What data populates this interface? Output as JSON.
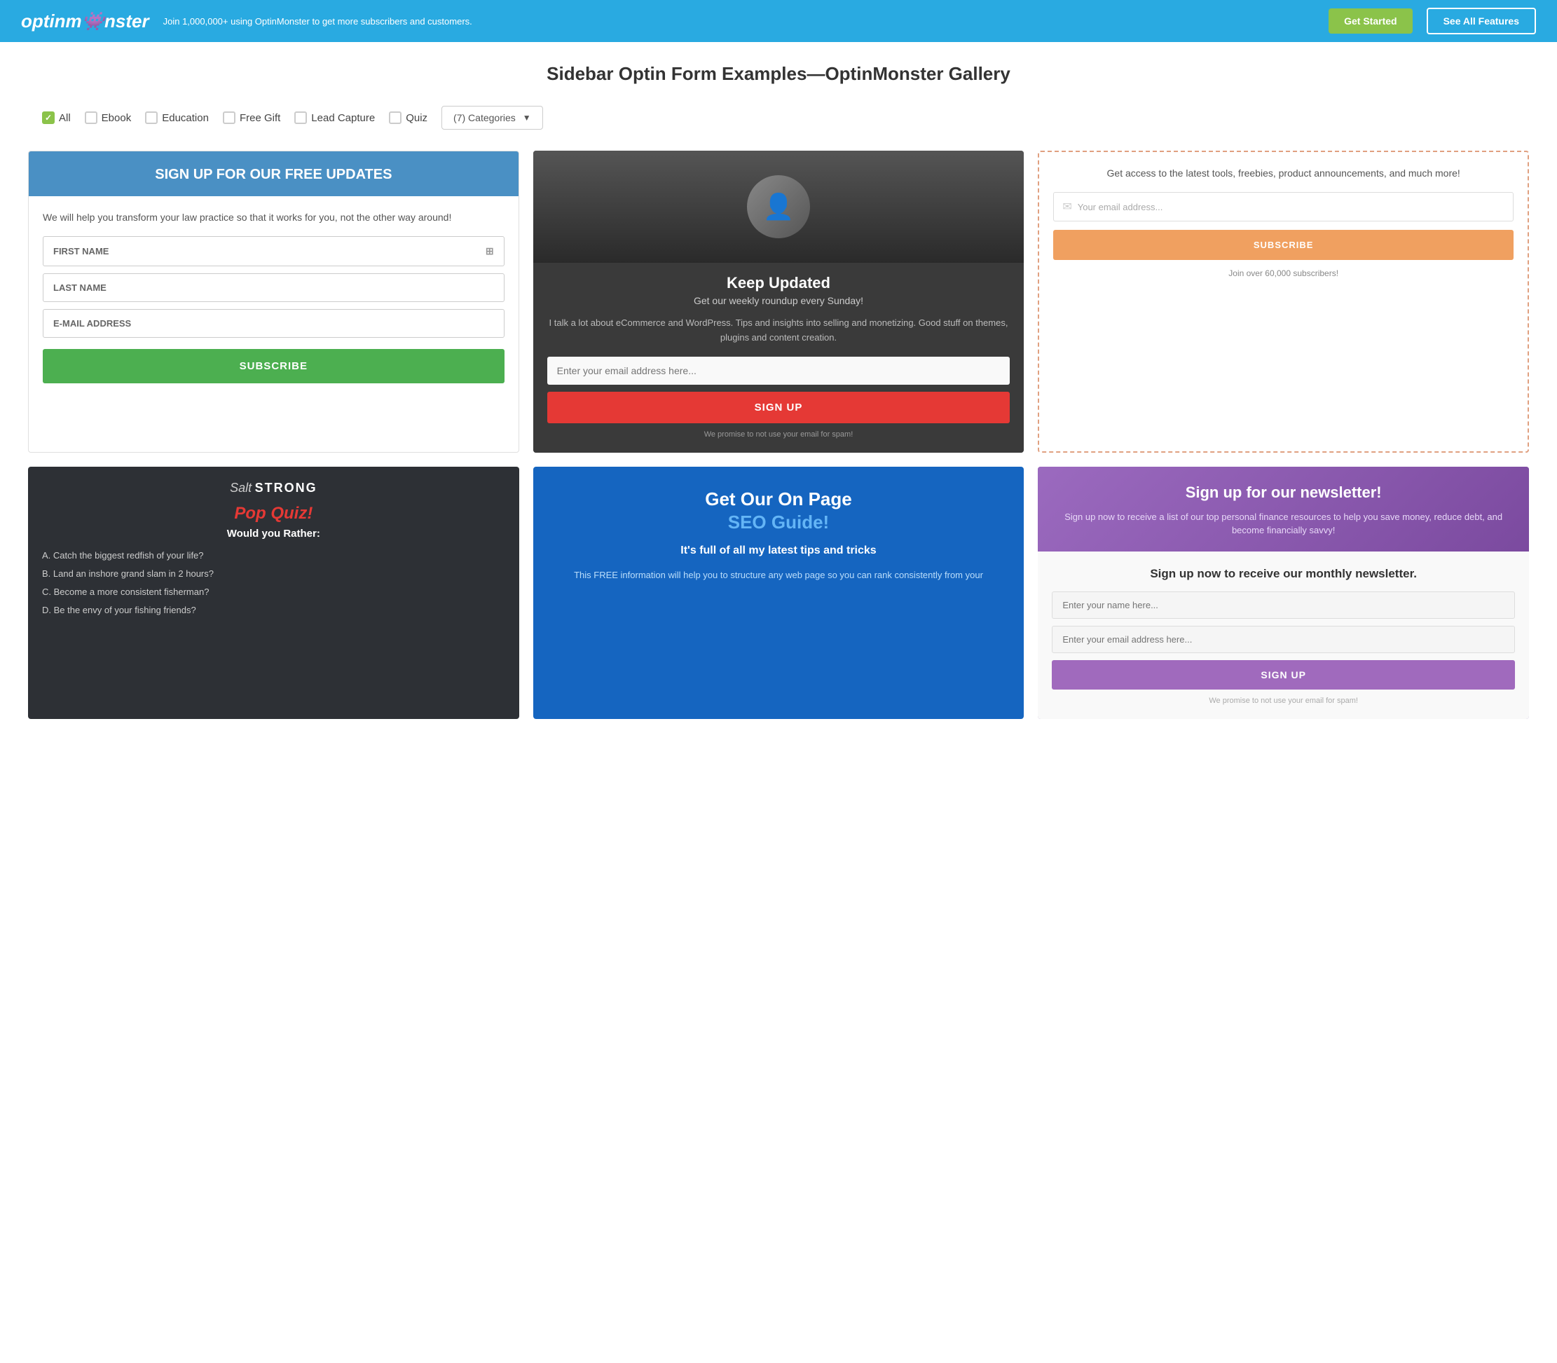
{
  "header": {
    "logo": "optinm",
    "logo_monster": "onster",
    "tagline": "Join 1,000,000+ using OptinMonster to get more subscribers and customers.",
    "btn_get_started": "Get Started",
    "btn_see_features": "See All Features"
  },
  "page": {
    "title": "Sidebar Optin Form Examples—OptinMonster Gallery"
  },
  "filters": {
    "all_label": "All",
    "ebook_label": "Ebook",
    "education_label": "Education",
    "free_gift_label": "Free Gift",
    "lead_capture_label": "Lead Capture",
    "quiz_label": "Quiz",
    "categories_label": "(7) Categories"
  },
  "cards": {
    "card1": {
      "header": "SIGN UP FOR OUR FREE UPDATES",
      "body": "We will help you transform your law practice so that it works for you, not the other way around!",
      "field1": "FIRST NAME",
      "field2": "LAST NAME",
      "field3": "E-MAIL ADDRESS",
      "subscribe_btn": "SUBSCRIBE"
    },
    "card2": {
      "title": "Keep Updated",
      "subtitle": "Get our weekly roundup every Sunday!",
      "desc": "I talk a lot about eCommerce and WordPress. Tips and insights into selling and monetizing. Good stuff on themes, plugins and content creation.",
      "email_placeholder": "Enter your email address here...",
      "signup_btn": "SIGN UP",
      "spam_note": "We promise to not use your email for spam!"
    },
    "card3": {
      "desc": "Get access to the latest tools, freebies, product announcements, and much more!",
      "email_placeholder": "Your email address...",
      "subscribe_btn": "SUBSCRIBE",
      "join_note": "Join over 60,000 subscribers!"
    },
    "card4": {
      "header_title": "Sign up for our newsletter!",
      "header_desc": "Sign up now to receive a list of our top personal finance resources to help you save money, reduce debt, and become financially savvy!",
      "body_title": "Sign up now to receive our monthly newsletter.",
      "name_placeholder": "Enter your name here...",
      "email_placeholder": "Enter your email address here...",
      "signup_btn": "SIGN UP",
      "spam_note": "We promise to not use your email for spam!"
    },
    "card5": {
      "logo_salt": "Salt",
      "logo_strong": "STRONG",
      "pop_quiz": "Pop Quiz!",
      "would_you": "Would you Rather:",
      "options": [
        "A.  Catch the biggest redfish of your life?",
        "B.  Land an inshore grand slam in 2 hours?",
        "C.  Become a more consistent fisherman?",
        "D.  Be the envy of your fishing friends?"
      ]
    },
    "card6": {
      "title_line1": "Get Our On Page",
      "title_line2": "SEO Guide!",
      "tagline": "It's full of all my latest tips and tricks",
      "desc": "This FREE information will help you to structure any web page so you can rank consistently from your"
    }
  }
}
